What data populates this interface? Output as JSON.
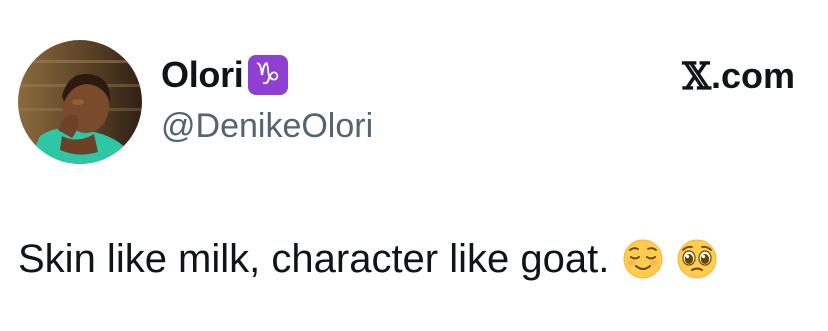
{
  "author": {
    "display_name": "Olori",
    "zodiac_badge": "♑",
    "handle": "@DenikeOlori",
    "avatar": "profile-photo"
  },
  "brand": {
    "x_glyph": "𝕏",
    "domain": ".com"
  },
  "tweet": {
    "text": "Skin like milk, character like goat.",
    "emojis": [
      "relieved-face-icon",
      "pleading-face-icon"
    ]
  },
  "colors": {
    "text": "#0f1419",
    "secondary": "#536471",
    "badge": "#8f3fd1"
  }
}
